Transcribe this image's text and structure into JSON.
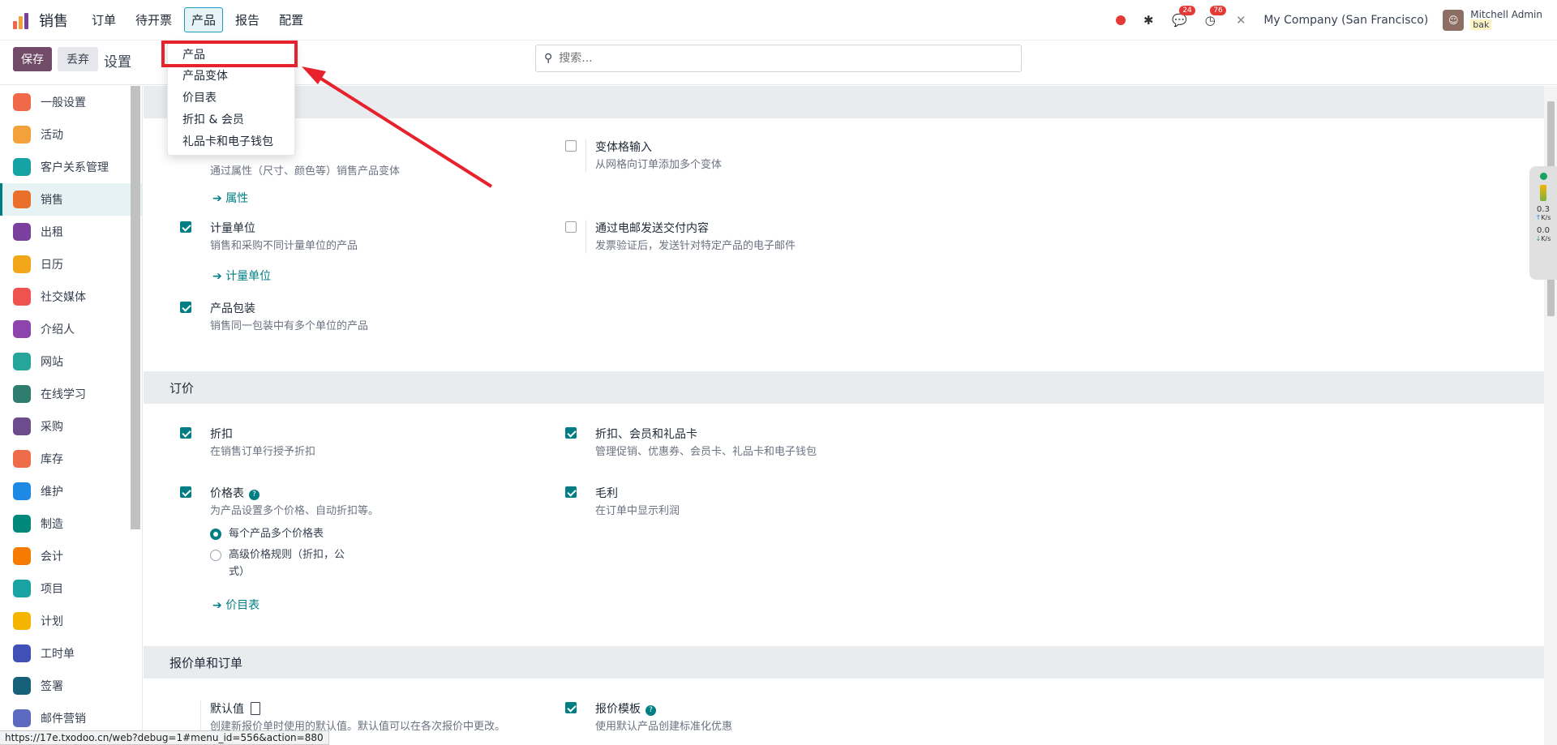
{
  "topnav": {
    "app_title": "销售",
    "menu": [
      {
        "label": "订单"
      },
      {
        "label": "待开票"
      },
      {
        "label": "产品"
      },
      {
        "label": "报告"
      },
      {
        "label": "配置"
      }
    ],
    "messages_count": "24",
    "activities_count": "76",
    "company": "My Company (San Francisco)",
    "user_name": "Mitchell Admin",
    "user_db": "bak"
  },
  "controlpanel": {
    "save_label": "保存",
    "discard_label": "丢弃",
    "title": "设置",
    "search_placeholder": "搜索..."
  },
  "dropdown": {
    "items": [
      {
        "label": "产品"
      },
      {
        "label": "产品变体"
      },
      {
        "label": "价目表"
      },
      {
        "label": "折扣 & 会员"
      },
      {
        "label": "礼品卡和电子钱包"
      }
    ]
  },
  "sidebar": {
    "items": [
      {
        "label": "一般设置",
        "icon": "general-settings-icon",
        "color": "#f06a4a"
      },
      {
        "label": "活动",
        "icon": "activity-icon",
        "color": "#f3a13a"
      },
      {
        "label": "客户关系管理",
        "icon": "crm-icon",
        "color": "#16a3a3"
      },
      {
        "label": "销售",
        "icon": "sales-icon",
        "color": "#e8702a"
      },
      {
        "label": "出租",
        "icon": "rental-icon",
        "color": "#7b3f9e"
      },
      {
        "label": "日历",
        "icon": "calendar-icon",
        "color": "#f2a71b"
      },
      {
        "label": "社交媒体",
        "icon": "social-icon",
        "color": "#ef5350"
      },
      {
        "label": "介绍人",
        "icon": "referral-icon",
        "color": "#8e44ad"
      },
      {
        "label": "网站",
        "icon": "website-icon",
        "color": "#26a69a"
      },
      {
        "label": "在线学习",
        "icon": "elearning-icon",
        "color": "#2e7d6f"
      },
      {
        "label": "采购",
        "icon": "purchase-icon",
        "color": "#6d4c8d"
      },
      {
        "label": "库存",
        "icon": "inventory-icon",
        "color": "#ef6c4a"
      },
      {
        "label": "维护",
        "icon": "maintenance-icon",
        "color": "#1e88e5"
      },
      {
        "label": "制造",
        "icon": "manufacturing-icon",
        "color": "#00897b"
      },
      {
        "label": "会计",
        "icon": "accounting-icon",
        "color": "#f57c00"
      },
      {
        "label": "项目",
        "icon": "project-icon",
        "color": "#1aa3a3"
      },
      {
        "label": "计划",
        "icon": "planning-icon",
        "color": "#f4b400"
      },
      {
        "label": "工时单",
        "icon": "timesheet-icon",
        "color": "#3f51b5"
      },
      {
        "label": "签署",
        "icon": "sign-icon",
        "color": "#17607a"
      },
      {
        "label": "邮件营销",
        "icon": "email-marketing-icon",
        "color": "#5c6bc0"
      }
    ]
  },
  "products": {
    "variants_desc": "通过属性（尺寸、颜色等）销售产品变体",
    "attributes_link": "属性",
    "grid_title": "变体格输入",
    "grid_desc": "从网格向订单添加多个变体",
    "uom_title": "计量单位",
    "uom_desc": "销售和采购不同计量单位的产品",
    "uom_link": "计量单位",
    "email_title": "通过电邮发送交付内容",
    "email_desc": "发票验证后，发送针对特定产品的电子邮件",
    "packaging_title": "产品包装",
    "packaging_desc": "销售同一包装中有多个单位的产品"
  },
  "pricing": {
    "heading": "订价",
    "discount_title": "折扣",
    "discount_desc": "在销售订单行授予折扣",
    "loyalty_title": "折扣、会员和礼品卡",
    "loyalty_desc": "管理促销、优惠券、会员卡、礼品卡和电子钱包",
    "pricelist_title": "价格表",
    "pricelist_desc": "为产品设置多个价格、自动折扣等。",
    "radio_multi": "每个产品多个价格表",
    "radio_advanced_1": "高级价格规则（折扣，公",
    "radio_advanced_2": "式）",
    "pricelist_link": "价目表",
    "margin_title": "毛利",
    "margin_desc": "在订单中显示利润"
  },
  "quotations": {
    "heading": "报价单和订单",
    "defaults_title": "默认值",
    "defaults_desc": "创建新报价单时使用的默认值。默认值可以在各次报价中更改。",
    "templates_title": "报价模板",
    "templates_desc": "使用默认产品创建标准化优惠"
  },
  "net_widget": {
    "up": "0.3",
    "down": "0.0",
    "unit": "K/s"
  },
  "status_url": "https://17e.txodoo.cn/web?debug=1#menu_id=556&action=880"
}
